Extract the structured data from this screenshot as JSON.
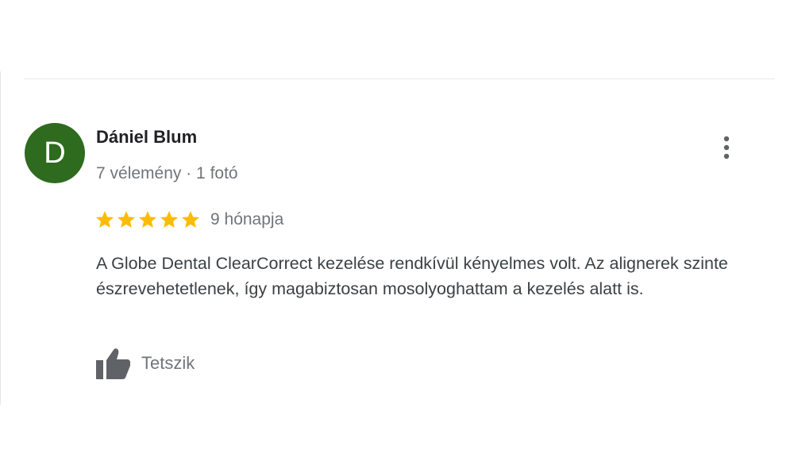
{
  "review": {
    "author": {
      "initial": "D",
      "name": "Dániel Blum",
      "meta": "7 vélemény · 1 fotó",
      "avatar_color": "#2e6b1f"
    },
    "rating": 5,
    "rating_max": 5,
    "star_color": "#fbbc04",
    "date": "9 hónapja",
    "text": "A Globe Dental ClearCorrect kezelése rendkívül kényelmes volt. Az alignerek szinte észrevehetetlenek, így magabiztosan mosolyoghattam a kezelés alatt is.",
    "actions": {
      "like_label": "Tetszik",
      "like_icon": "thumbs-up-icon",
      "more_icon": "more-vert-icon"
    }
  }
}
